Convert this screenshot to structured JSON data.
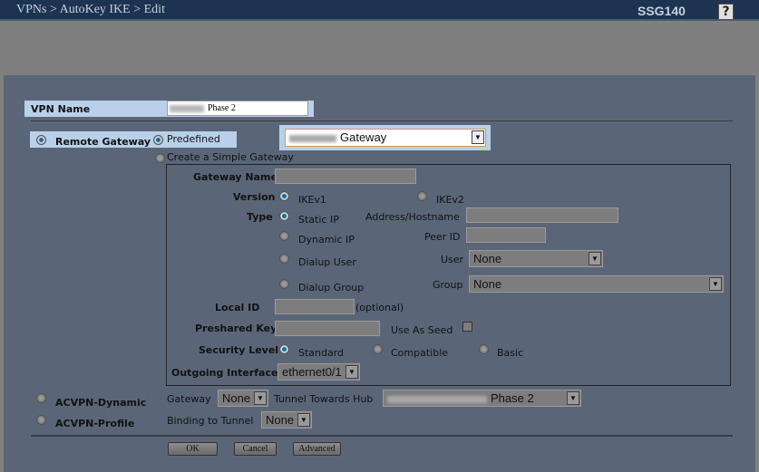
{
  "header": {
    "breadcrumb": "VPNs > AutoKey IKE > Edit",
    "model": "SSG140",
    "help_label": "?"
  },
  "vpn_name": {
    "label": "VPN Name",
    "value_visible": "Phase 2"
  },
  "remote_gateway": {
    "label": "Remote Gateway",
    "selected": true,
    "predefined_label": "Predefined",
    "predefined_selected": true,
    "gateway_select_visible": "Gateway",
    "create_simple_label": "Create a Simple Gateway"
  },
  "simple_gateway": {
    "gateway_name_label": "Gateway Name",
    "version_label": "Version",
    "ikev1": "IKEv1",
    "ikev2": "IKEv2",
    "version_selected": "IKEv1",
    "type_label": "Type",
    "static_ip": "Static IP",
    "dynamic_ip": "Dynamic IP",
    "dialup_user": "Dialup User",
    "dialup_group": "Dialup Group",
    "type_selected": "Static IP",
    "address_label": "Address/Hostname",
    "peer_id_label": "Peer ID",
    "user_label": "User",
    "user_value": "None",
    "group_label": "Group",
    "group_value": "None",
    "local_id_label": "Local ID",
    "optional": "(optional)",
    "psk_label": "Preshared Key",
    "seed_label": "Use As Seed",
    "seed_checked": false,
    "security_label": "Security Level",
    "standard": "Standard",
    "compatible": "Compatible",
    "basic": "Basic",
    "security_selected": "Standard",
    "outgoing_label": "Outgoing Interface",
    "outgoing_value": "ethernet0/1"
  },
  "acvpn_dynamic": {
    "label": "ACVPN-Dynamic",
    "gateway_label": "Gateway",
    "gateway_value": "None",
    "tunnel_label": "Tunnel Towards Hub",
    "tunnel_value_visible": "Phase 2"
  },
  "acvpn_profile": {
    "label": "ACVPN-Profile",
    "binding_label": "Binding to Tunnel",
    "binding_value": "None"
  },
  "buttons": {
    "ok": "OK",
    "cancel": "Cancel",
    "advanced": "Advanced"
  },
  "colors": {
    "header": "#1c3452",
    "panel": "#5a6678",
    "highlight": "#b9d0ea"
  }
}
